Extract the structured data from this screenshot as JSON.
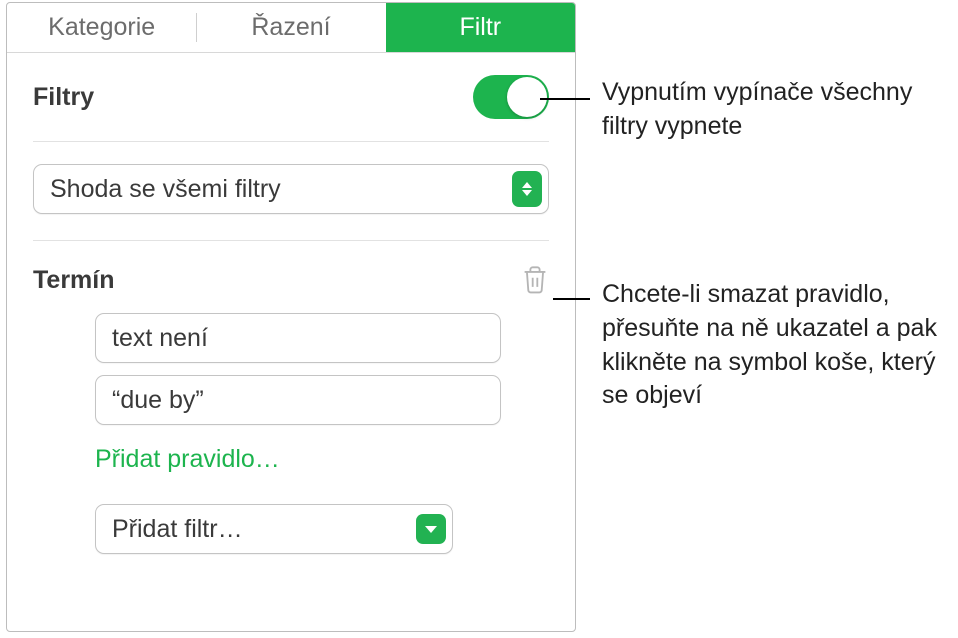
{
  "tabs": {
    "categories": "Kategorie",
    "sort": "Řazení",
    "filter": "Filtr"
  },
  "filters": {
    "title": "Filtry",
    "match_select": "Shoda se všemi filtry"
  },
  "rule": {
    "title": "Termín",
    "condition": "text není",
    "value": "“due by”",
    "add_rule": "Přidat pravidlo…",
    "add_filter": "Přidat filtr…"
  },
  "callouts": {
    "toggle": "Vypnutím vypínače všechny filtry vypnete",
    "trash": "Chcete-li smazat pravidlo, přesuňte na ně ukazatel a pak klikněte na symbol koše, který se objeví"
  }
}
